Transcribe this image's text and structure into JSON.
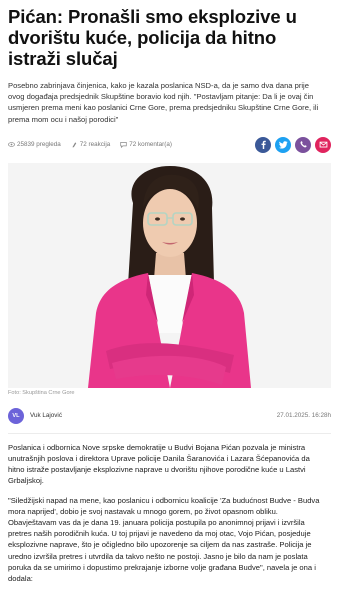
{
  "article": {
    "title": "Pićan: Pronašli smo eksplozive u dvorištu kuće, policija da hitno istraži slučaj",
    "lead": "Posebno zabrinjava činjenica, kako je kazala poslanica NSD-a, da je samo dva dana prije ovog događaja predsjednik Skupštine boravio kod njih. \"Postavljam pitanje: Da li je ovaj čin usmjeren prema meni kao poslanici Crne Gore, prema predsjedniku Skupštine Crne Gore, ili prema mom ocu i našoj porodici\"",
    "stats": {
      "views": "25839 pregleda",
      "reactions": "72 reakcija",
      "comments": "72 komentar(a)"
    },
    "image_caption": "Foto: Skupština Crne Gore",
    "author": {
      "initials": "VL",
      "name": "Vuk Lajović"
    },
    "date": "27.01.2025. 16:28h",
    "paragraphs": [
      "Poslanica i odbornica Nove srpske demokratije u Budvi Bojana Pićan pozvala je ministra unutrašnjih poslova i direktora Uprave policije Danila Šaranovića i Lazara Šćepanovića da hitno istraže postavljanje eksplozivne naprave u dvorištu njihove porodične kuće u Lastvi Grbaljskoj.",
      "\"Siledžijski napad na mene, kao poslanicu i odbornicu koalicije 'Za budućnost Budve - Budva mora naprijed', dobio je svoj nastavak u mnogo gorem, po život opasnom obliku. Obavještavam vas da je dana 19. januara policija postupila po anonimnoj prijavi i izvršila pretres naših porodičnih kuća. U toj prijavi je navedeno da moj otac, Vojo Pićan, posjeduje eksplozivne naprave, što je očigledno bilo upozorenje sa ciljem da nas zastraše. Policija je uredno izvršila pretres i utvrdila da takvo nešto ne postoji. Jasno je bilo da nam je poslata poruka da se umirimo i dopustimo prekrajanje izborne volje građana Budve\", navela je ona i dodala:"
    ]
  },
  "share_buttons": [
    {
      "name": "facebook",
      "color": "#3b5998",
      "glyph": "f"
    },
    {
      "name": "twitter",
      "color": "#1da1f2",
      "glyph": "t"
    },
    {
      "name": "viber",
      "color": "#7b519d",
      "glyph": "v"
    },
    {
      "name": "email",
      "color": "#e0245e",
      "glyph": "m"
    }
  ]
}
